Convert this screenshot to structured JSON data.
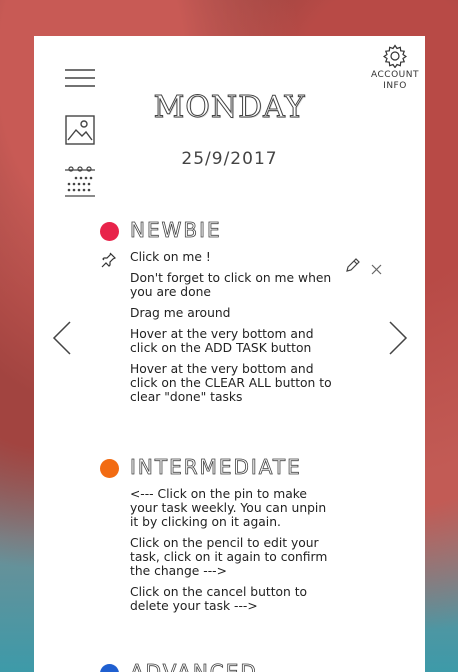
{
  "account": {
    "label_line1": "ACCOUNT",
    "label_line2": "INFO"
  },
  "header": {
    "day": "MONDAY",
    "date": "25/9/2017"
  },
  "sections": [
    {
      "title": "NEWBIE",
      "color": "#e8234a",
      "tasks": [
        "Click on me !",
        "Don't forget to click on me when you are done",
        "Drag me around",
        "Hover at the very bottom and click on the ADD TASK button",
        "Hover at the very bottom and click on the CLEAR ALL button to clear \"done\" tasks"
      ]
    },
    {
      "title": "INTERMEDIATE",
      "color": "#f26b12",
      "tasks": [
        "<--- Click on the pin to make your task weekly. You can unpin it by clicking on it again.",
        "Click on the pencil to edit your task, click on it again to confirm the change --->",
        "Click on the cancel button to delete your task --->"
      ]
    },
    {
      "title": "ADVANCED",
      "color": "#1f5fd0",
      "tasks": []
    }
  ],
  "icons": {
    "menu": "hamburger-icon",
    "gallery": "image-icon",
    "calendar": "calendar-icon",
    "settings": "gear-icon",
    "prev": "chevron-left-icon",
    "next": "chevron-right-icon",
    "pin": "pin-icon",
    "edit": "pencil-icon",
    "delete": "close-icon"
  }
}
